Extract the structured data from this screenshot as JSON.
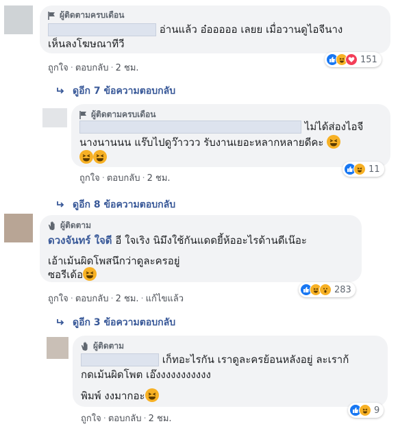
{
  "comments": [
    {
      "badge": "ผู้ติดตามครบเดือน",
      "lines": [
        "อ่านแล้ว อ๋อออออ เลยย เมื่อวานดูไอจีนาง",
        "เห็นลงโฆษณาทีวี"
      ],
      "actions": [
        "ถูกใจ",
        "ตอบกลับ",
        "2 ชม."
      ],
      "reaction_count": "151",
      "reactions": [
        "like-icon",
        "haha-icon",
        "love-icon"
      ]
    },
    {
      "badge": "ผู้ติดตามครบเดือน",
      "lines": [
        "ไม่ได้ส่องไอจี",
        "นางนานนน แร๊บไปดูว๊าววว รับงานเยอะหลากหลายดีคะ"
      ],
      "actions": [
        "ถูกใจ",
        "ตอบกลับ",
        "2 ชม."
      ],
      "reaction_count": "11",
      "reactions": [
        "like-icon",
        "haha-icon"
      ]
    },
    {
      "badge": "ผู้ติดตาม",
      "name": "ดวงจันทร์ ใจดี",
      "lines": [
        "อี ใจเริง นิมึงใช้กันแดดยี้ห้ออะไรด้านดีเน๊อะ",
        "เอ้าเม้นผิดโพสนึกว่าดูละครอยู่",
        "ซอรีเด้อ"
      ],
      "actions": [
        "ถูกใจ",
        "ตอบกลับ",
        "2 ชม.",
        "แก้ไขแล้ว"
      ],
      "reaction_count": "283",
      "reactions": [
        "like-icon",
        "haha-icon",
        "wow-icon"
      ]
    },
    {
      "badge": "ผู้ติดตาม",
      "lines": [
        "เก็ทอะไรกัน เราดูละครย้อนหลังอยู่ ละเราก้",
        "กดเม้นผิดโพต เอ๊งงงงงงงงงงง",
        "พิมพ์ งงมากอะ"
      ],
      "actions": [
        "ถูกใจ",
        "ตอบกลับ",
        "2 ชม."
      ],
      "reaction_count": "9",
      "reactions": [
        "like-icon",
        "haha-icon"
      ]
    }
  ],
  "more_replies": [
    "ดูอีก 7 ข้อความตอบกลับ",
    "ดูอีก 8 ข้อความตอบกลับ",
    "ดูอีก 3 ข้อความตอบกลับ"
  ],
  "colors": {
    "bubble": "#f2f3f5",
    "link": "#385898",
    "like": "#1877f2",
    "haha": "#f7b125",
    "love": "#f33e58"
  }
}
